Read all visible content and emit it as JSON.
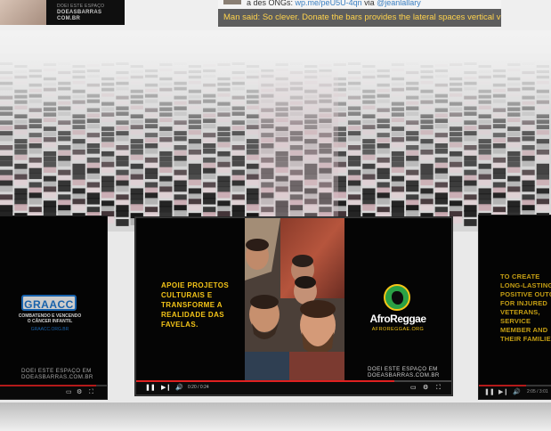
{
  "top_thumbnail": {
    "text_line1": "DOEI ESTE ESPAÇO",
    "text_line2": "DOEASBARRAS",
    "text_line3": "COM.BR"
  },
  "tweet": {
    "line_prefix": "a des ONGs:",
    "link": "wp.me/peU5U-4qn",
    "via_text": "via",
    "handle": "@jeanlallary",
    "highlight": "Man said: So clever. Donate the bars provides the lateral spaces vertical videos NGOs:"
  },
  "phones": {
    "left": {
      "logo_text": "GRAACC",
      "subtitle": "COMBATENDO E VENCENDO O CÂNCER INFANTIL",
      "url": "GRAACC.ORG.BR",
      "donate_line1": "DOEI ESTE ESPAÇO EM",
      "donate_line2": "DOEASBARRAS.COM.BR"
    },
    "center": {
      "left_message": "APOIE PROJETOS CULTURAIS E TRANSFORME A REALIDADE DAS FAVELAS.",
      "logo_text": "AfroReggae",
      "url": "AFROREGGAE.ORG",
      "donate_line1": "DOEI ESTE ESPAÇO EM",
      "donate_line2": "DOEASBARRAS.COM.BR",
      "time": "0:20 / 0:24",
      "progress": 0.82
    },
    "right": {
      "message": "TO CREATE LONG-LASTING POSITIVE OUTCO FOR INJURED VETERANS, SERVICE MEMBER AND THEIR FAMILIES.",
      "time": "2:05 / 3:01",
      "progress": 0.65
    }
  },
  "colors": {
    "yellow": "#f5c518",
    "graacc_blue": "#1f7bd6",
    "progress_red": "#e02020",
    "tweet_highlight": "#ffd34d",
    "afro_green": "#2aa145"
  },
  "icons": [
    "play-icon",
    "next-icon",
    "volume-icon",
    "captions-icon",
    "settings-icon",
    "fullscreen-icon"
  ]
}
